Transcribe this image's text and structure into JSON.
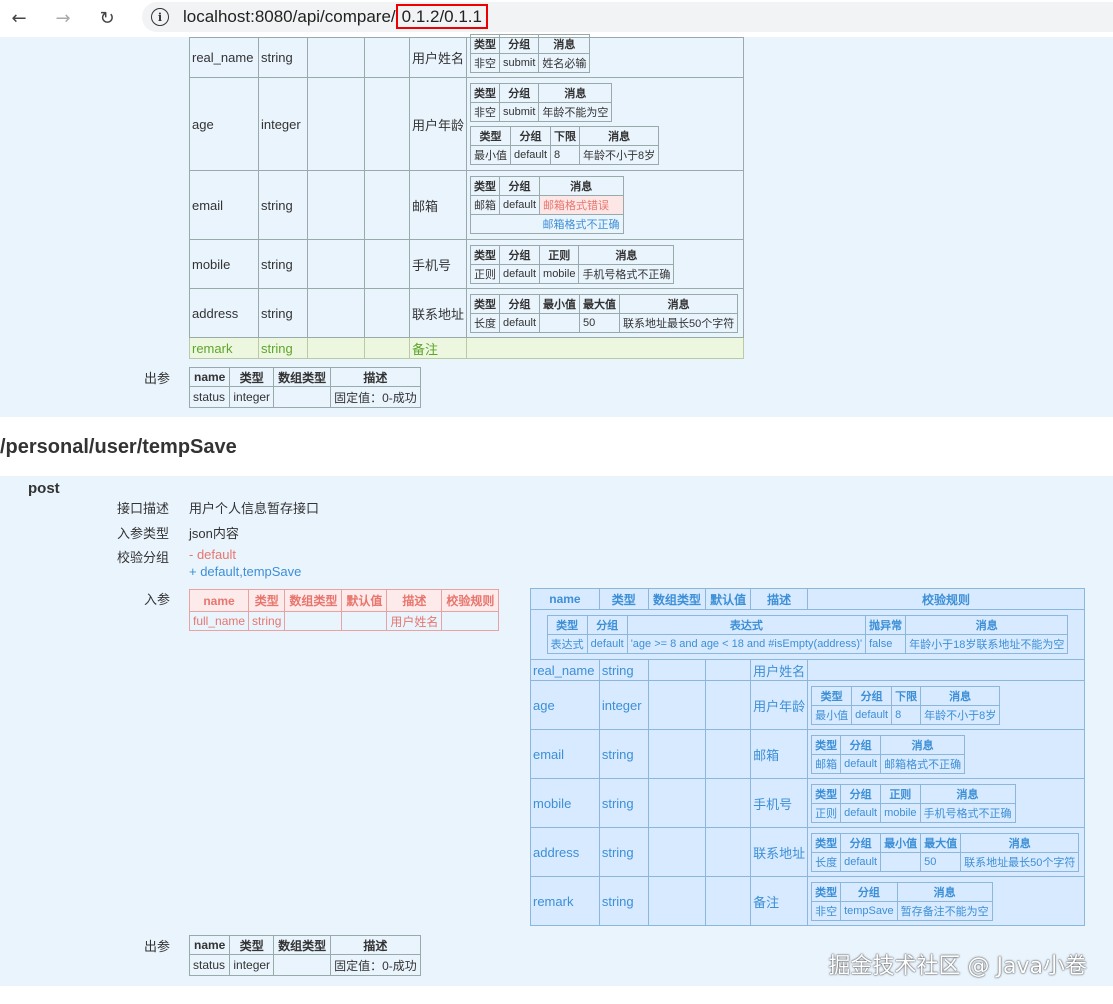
{
  "browser": {
    "url_prefix": "localhost:8080/api/compare/",
    "url_version": "0.1.2/0.1.1"
  },
  "sec1": {
    "rows": [
      {
        "name": "real_name",
        "type": "string",
        "desc": "用户姓名",
        "rules": {
          "hdr": [
            "类型",
            "分组",
            "消息"
          ],
          "rows": [
            [
              "非空",
              "submit",
              "姓名必输"
            ]
          ]
        }
      },
      {
        "name": "age",
        "type": "integer",
        "desc": "用户年龄",
        "rules": {
          "hdr": [
            "类型",
            "分组",
            "消息"
          ],
          "rows": [
            [
              "非空",
              "submit",
              "年龄不能为空"
            ]
          ]
        },
        "rules2": {
          "hdr": [
            "类型",
            "分组",
            "下限",
            "消息"
          ],
          "rows": [
            [
              "最小值",
              "default",
              "8",
              "年龄不小于8岁"
            ]
          ]
        }
      },
      {
        "name": "email",
        "type": "string",
        "desc": "邮箱",
        "rules": {
          "hdr": [
            "类型",
            "分组",
            "消息"
          ],
          "rows": [
            [
              "邮箱",
              "default",
              "邮箱格式错误"
            ]
          ],
          "extra": "邮箱格式不正确"
        }
      },
      {
        "name": "mobile",
        "type": "string",
        "desc": "手机号",
        "rules": {
          "hdr": [
            "类型",
            "分组",
            "正则",
            "消息"
          ],
          "rows": [
            [
              "正则",
              "default",
              "mobile",
              "手机号格式不正确"
            ]
          ]
        }
      },
      {
        "name": "address",
        "type": "string",
        "desc": "联系地址",
        "rules": {
          "hdr": [
            "类型",
            "分组",
            "最小值",
            "最大值",
            "消息"
          ],
          "rows": [
            [
              "长度",
              "default",
              "",
              "50",
              "联系地址最长50个字符"
            ]
          ]
        }
      },
      {
        "name": "remark",
        "type": "string",
        "desc": "备注"
      }
    ],
    "out_label": "出参",
    "out": {
      "hdr": [
        "name",
        "类型",
        "数组类型",
        "描述"
      ],
      "rows": [
        [
          "status",
          "integer",
          "",
          "固定值：0-成功"
        ]
      ]
    }
  },
  "sec2": {
    "title": "/personal/user/tempSave",
    "method": "post",
    "meta": [
      {
        "k": "接口描述",
        "v": "用户个人信息暂存接口"
      },
      {
        "k": "入参类型",
        "v": "json内容"
      },
      {
        "k": "校验分组",
        "v": ""
      }
    ],
    "group_removed": "- default",
    "group_added": "+ default,tempSave",
    "in_label": "入参",
    "old_hdr": [
      "name",
      "类型",
      "数组类型",
      "默认值",
      "描述",
      "校验规则"
    ],
    "old_row": [
      "full_name",
      "string",
      "",
      "",
      "用户姓名",
      ""
    ],
    "new_hdr": [
      "name",
      "类型",
      "数组类型",
      "默认值",
      "描述",
      "校验规则"
    ],
    "expr_hdr": [
      "类型",
      "分组",
      "表达式",
      "抛异常",
      "消息"
    ],
    "expr_row": [
      "表达式",
      "default",
      "'age >= 8 and age < 18 and #isEmpty(address)'",
      "false",
      "年龄小于18岁联系地址不能为空"
    ],
    "new_rows": [
      {
        "name": "real_name",
        "type": "string",
        "desc": "用户姓名"
      },
      {
        "name": "age",
        "type": "integer",
        "desc": "用户年龄",
        "rules": {
          "hdr": [
            "类型",
            "分组",
            "下限",
            "消息"
          ],
          "rows": [
            [
              "最小值",
              "default",
              "8",
              "年龄不小于8岁"
            ]
          ]
        }
      },
      {
        "name": "email",
        "type": "string",
        "desc": "邮箱",
        "rules": {
          "hdr": [
            "类型",
            "分组",
            "消息"
          ],
          "rows": [
            [
              "邮箱",
              "default",
              "邮箱格式不正确"
            ]
          ]
        }
      },
      {
        "name": "mobile",
        "type": "string",
        "desc": "手机号",
        "rules": {
          "hdr": [
            "类型",
            "分组",
            "正则",
            "消息"
          ],
          "rows": [
            [
              "正则",
              "default",
              "mobile",
              "手机号格式不正确"
            ]
          ]
        }
      },
      {
        "name": "address",
        "type": "string",
        "desc": "联系地址",
        "rules": {
          "hdr": [
            "类型",
            "分组",
            "最小值",
            "最大值",
            "消息"
          ],
          "rows": [
            [
              "长度",
              "default",
              "",
              "50",
              "联系地址最长50个字符"
            ]
          ]
        }
      },
      {
        "name": "remark",
        "type": "string",
        "desc": "备注",
        "rules": {
          "hdr": [
            "类型",
            "分组",
            "消息"
          ],
          "rows": [
            [
              "非空",
              "tempSave",
              "暂存备注不能为空"
            ]
          ]
        }
      }
    ],
    "out_label": "出参",
    "out": {
      "hdr": [
        "name",
        "类型",
        "数组类型",
        "描述"
      ],
      "rows": [
        [
          "status",
          "integer",
          "",
          "固定值：0-成功"
        ]
      ]
    }
  },
  "watermark": "掘金技术社区 @ Java小卷"
}
